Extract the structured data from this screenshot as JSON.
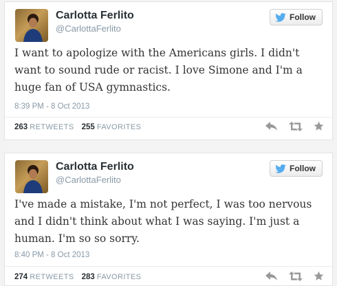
{
  "tweets": [
    {
      "name": "Carlotta Ferlito",
      "handle": "@CarlottaFerlito",
      "follow_label": "Follow",
      "text": "I want to apologize with the Americans girls. I didn't want to sound rude or racist. I love Simone and I'm a huge fan of USA gymnastics.",
      "timestamp": "8:39 PM - 8 Oct 2013",
      "retweets_count": "263",
      "retweets_label": "RETWEETS",
      "favorites_count": "255",
      "favorites_label": "FAVORITES"
    },
    {
      "name": "Carlotta Ferlito",
      "handle": "@CarlottaFerlito",
      "follow_label": "Follow",
      "text": "I've made a mistake, I'm not perfect, I was too nervous and I didn't think about what I was saying. I'm just a human. I'm so so sorry.",
      "timestamp": "8:40 PM - 8 Oct 2013",
      "retweets_count": "274",
      "retweets_label": "RETWEETS",
      "favorites_count": "283",
      "favorites_label": "FAVORITES"
    }
  ],
  "colors": {
    "twitter_blue": "#55acee",
    "action_gray": "#999999",
    "text": "#333333"
  },
  "icons": {
    "follow": "twitter-bird-icon",
    "reply": "reply-icon",
    "retweet": "retweet-icon",
    "favorite": "star-icon"
  }
}
